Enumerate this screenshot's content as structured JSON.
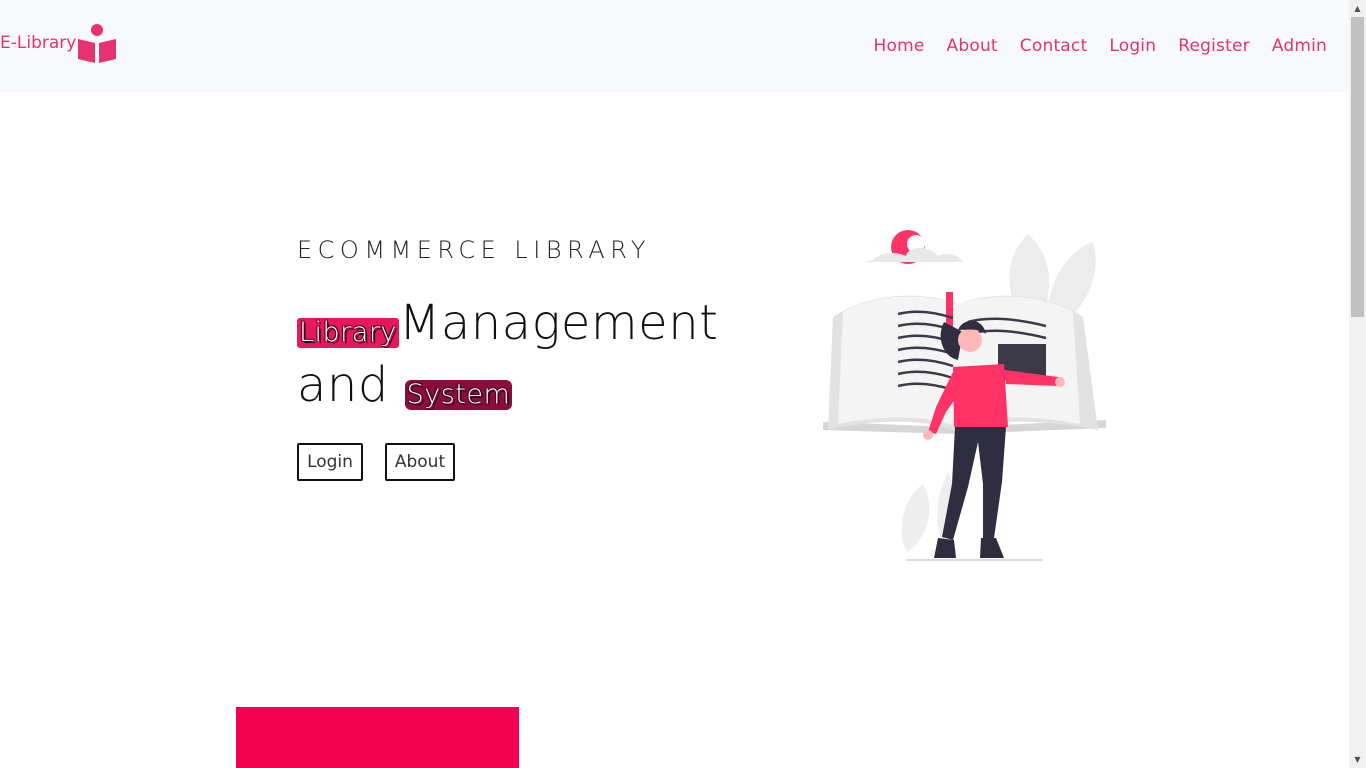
{
  "brand": {
    "name": "E-Library",
    "icon": "reading-book-icon",
    "color": "#e8326e"
  },
  "nav": {
    "items": [
      {
        "label": "Home"
      },
      {
        "label": "About"
      },
      {
        "label": "Contact"
      },
      {
        "label": "Login"
      },
      {
        "label": "Register"
      },
      {
        "label": "Admin"
      }
    ]
  },
  "hero": {
    "kicker": "ECOMMERCE LIBRARY",
    "title_word_1": "Library",
    "title_word_2": "Management",
    "title_word_3": "and",
    "title_word_4": "System",
    "login_button": "Login",
    "about_button": "About"
  },
  "colors": {
    "accent": "#f40051",
    "accent_dark": "#8e0c3c",
    "nav_bg": "#f7f9fd"
  },
  "illustration": {
    "icon": "woman-reading-book-illustration"
  }
}
